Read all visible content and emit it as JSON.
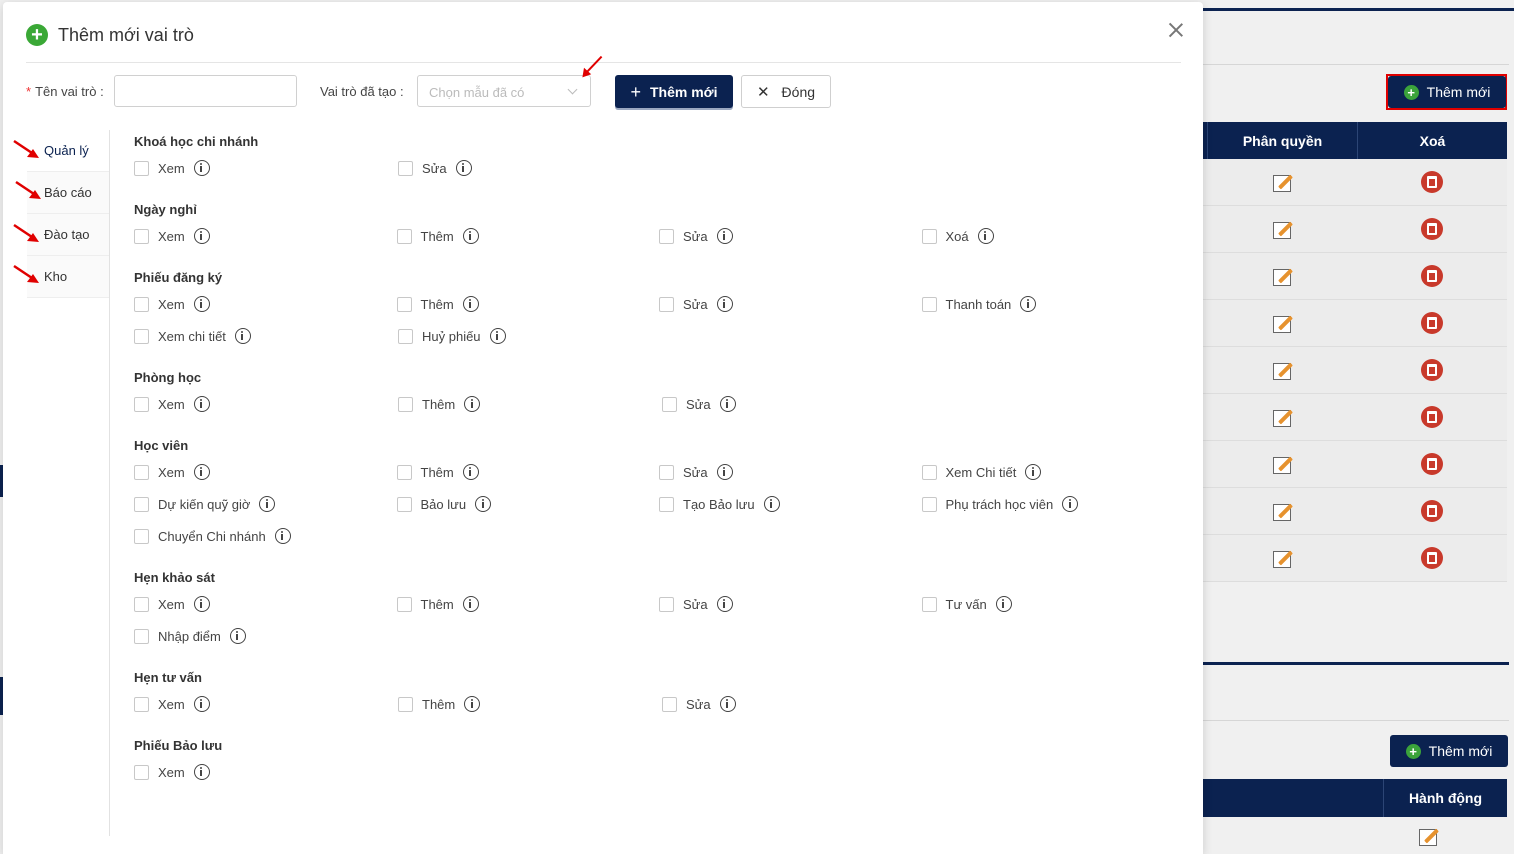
{
  "background": {
    "add_button_label": "Thêm mới",
    "table_headers": [
      "Phân quyền",
      "Xoá"
    ],
    "row_count": 9,
    "add_button_label_2": "Thêm mới",
    "table2_header": "Hành động"
  },
  "modal": {
    "title": "Thêm mới vai trò",
    "role_name_label": "Tên vai trò :",
    "role_name_value": "",
    "template_label": "Vai trò đã tạo :",
    "template_placeholder": "Chọn mẫu đã có",
    "add_button": "Thêm mới",
    "close_button": "Đóng"
  },
  "tabs": [
    {
      "label": "Quản lý",
      "active": true
    },
    {
      "label": "Báo cáo",
      "active": false
    },
    {
      "label": "Đào tạo",
      "active": false
    },
    {
      "label": "Kho",
      "active": false
    }
  ],
  "groups": [
    {
      "title": "Khoá học chi nhánh",
      "rows": [
        [
          "Xem",
          "Sửa"
        ]
      ]
    },
    {
      "title": "Ngày nghỉ",
      "rows": [
        [
          "Xem",
          "Thêm",
          "Sửa",
          "Xoá"
        ]
      ]
    },
    {
      "title": "Phiếu đăng ký",
      "rows": [
        [
          "Xem",
          "Thêm",
          "Sửa",
          "Thanh toán"
        ],
        [
          "Xem chi tiết",
          "Huỷ phiếu"
        ]
      ]
    },
    {
      "title": "Phòng học",
      "rows": [
        [
          "Xem",
          "Thêm",
          "Sửa"
        ]
      ]
    },
    {
      "title": "Học viên",
      "rows": [
        [
          "Xem",
          "Thêm",
          "Sửa",
          "Xem Chi tiết"
        ],
        [
          "Dự kiến quỹ giờ",
          "Bảo lưu",
          "Tạo Bảo lưu",
          "Phụ trách học viên"
        ],
        [
          "Chuyển Chi nhánh"
        ]
      ]
    },
    {
      "title": "Hẹn khảo sát",
      "rows": [
        [
          "Xem",
          "Thêm",
          "Sửa",
          "Tư vấn"
        ],
        [
          "Nhập điểm"
        ]
      ]
    },
    {
      "title": "Hẹn tư vấn",
      "rows": [
        [
          "Xem",
          "Thêm",
          "Sửa"
        ]
      ]
    },
    {
      "title": "Phiếu Bảo lưu",
      "rows": [
        [
          "Xem"
        ]
      ]
    }
  ],
  "colors": {
    "navy": "#0b2250",
    "accent_green": "#3aa836",
    "annotation_red": "#e00000"
  }
}
